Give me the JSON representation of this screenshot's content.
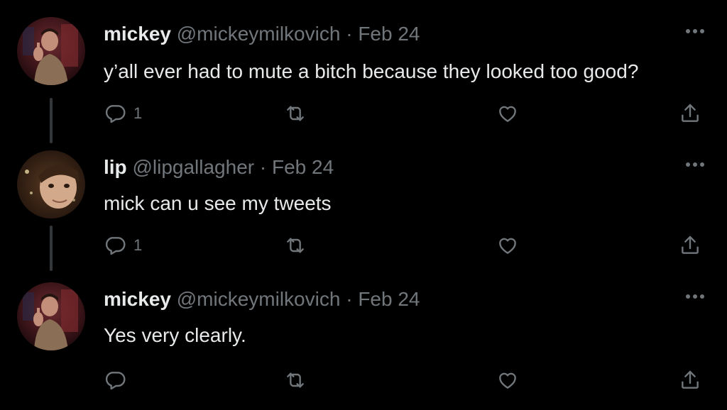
{
  "tweets": [
    {
      "name": "mickey",
      "handle": "@mickeymilkovich",
      "separator": "·",
      "date": "Feb 24",
      "text": "y’all ever had to mute a bitch because they looked too good?",
      "reply_count": "1",
      "avatar_icon": "avatar-mickey"
    },
    {
      "name": "lip",
      "handle": "@lipgallagher",
      "separator": "·",
      "date": "Feb 24",
      "text": "mick can u see my tweets",
      "reply_count": "1",
      "avatar_icon": "avatar-lip"
    },
    {
      "name": "mickey",
      "handle": "@mickeymilkovich",
      "separator": "·",
      "date": "Feb 24",
      "text": "Yes very clearly.",
      "reply_count": "",
      "avatar_icon": "avatar-mickey"
    }
  ],
  "colors": {
    "background": "#000000",
    "text_primary": "#e7e9ea",
    "text_secondary": "#71767b",
    "thread_line": "#333639"
  },
  "icons": [
    "reply-icon",
    "retweet-icon",
    "like-icon",
    "share-icon",
    "more-options-icon"
  ]
}
